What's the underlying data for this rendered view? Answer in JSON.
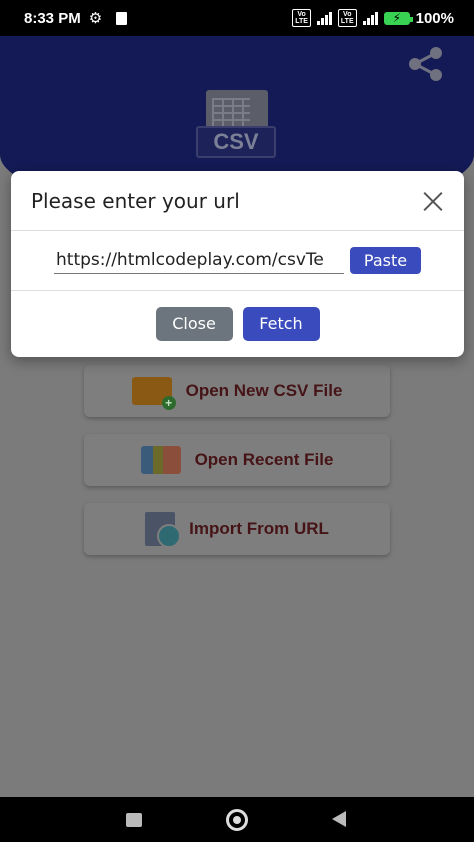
{
  "status_bar": {
    "time": "8:33 PM",
    "volte_1": "Vo\nLTE",
    "volte_2": "Vo\nLTE",
    "battery": "100%"
  },
  "menu": {
    "open_new": "Open New CSV File",
    "open_recent": "Open Recent File",
    "import_url": "Import From URL"
  },
  "logo": {
    "label": "CSV"
  },
  "dialog": {
    "title": "Please enter your url",
    "url_value": "https://htmlcodeplay.com/csvTe",
    "paste_label": "Paste",
    "close_label": "Close",
    "fetch_label": "Fetch"
  },
  "colors": {
    "primary": "#3a4bbd",
    "header": "#141a55",
    "secondary_button": "#6c757d",
    "menu_text": "#461416"
  }
}
